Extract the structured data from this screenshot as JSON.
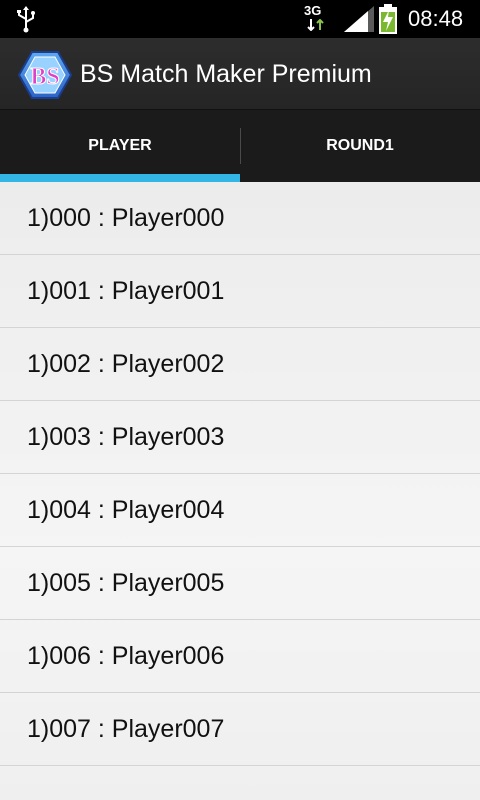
{
  "statusbar": {
    "network": "3G",
    "time": "08:48",
    "icons": [
      "usb-icon",
      "3g-data-icon",
      "signal-icon",
      "battery-charging-icon"
    ]
  },
  "actionbar": {
    "icon_text": "BS",
    "title": "BS Match Maker Premium"
  },
  "tabs": [
    {
      "label": "PLAYER",
      "selected": true
    },
    {
      "label": "ROUND1",
      "selected": false
    }
  ],
  "colors": {
    "accent": "#33b5e5",
    "actionbar": "#2a2a2a",
    "list_bg": "#efefef"
  },
  "players": [
    {
      "label": "1)000 : Player000"
    },
    {
      "label": "1)001 : Player001"
    },
    {
      "label": "1)002 : Player002"
    },
    {
      "label": "1)003 : Player003"
    },
    {
      "label": "1)004 : Player004"
    },
    {
      "label": "1)005 : Player005"
    },
    {
      "label": "1)006 : Player006"
    },
    {
      "label": "1)007 : Player007"
    }
  ]
}
